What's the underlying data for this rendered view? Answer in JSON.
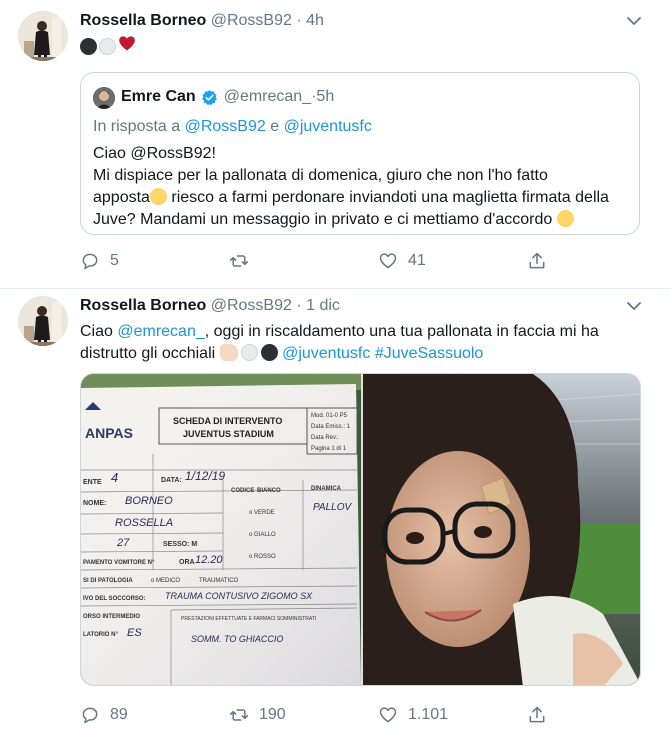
{
  "colors": {
    "link": "#1b95e0",
    "muted": "#657786",
    "text": "#14171a",
    "border": "#e6ecf0",
    "verified": "#1da1f2"
  },
  "tweet1": {
    "author_name": "Rossella Borneo",
    "handle": "@RossB92",
    "separator": " · ",
    "time": "4h",
    "emojis": [
      "black-circle",
      "white-circle",
      "red-heart"
    ],
    "quote": {
      "author_name": "Emre Can",
      "handle": "@emrecan_",
      "separator": " · ",
      "time": "5h",
      "reply_prefix": "In risposta a ",
      "reply_user1": "@RossB92",
      "reply_conj": " e ",
      "reply_user2": "@juventusfc",
      "line1": "Ciao @RossB92!",
      "line2": "Mi dispiace per la pallonata di domenica, giuro che non l'ho fatto",
      "line3_a": "apposta",
      "line3_b": " riesco a farmi perdonare inviandoti una maglietta firmata della",
      "line4": "Juve? Mandami un messaggio in privato e ci mettiamo d'accordo "
    },
    "actions": {
      "replies": "5",
      "retweets": "",
      "likes": "41"
    }
  },
  "tweet2": {
    "author_name": "Rossella Borneo",
    "handle": "@RossB92",
    "separator": " · ",
    "time": "1 dic",
    "text_a": "Ciao ",
    "mention": "@emrecan_",
    "text_b": ", oggi in riscaldamento una tua pallonata in faccia mi ha",
    "text_c": "distrutto gli occhiali ",
    "mention2": "@juventusfc",
    "hashtag": "#JuveSassuolo",
    "media": {
      "form": {
        "brand": "ANPAS",
        "title1": "SCHEDA DI INTERVENTO",
        "title2": "JUVENTUS STADIUM",
        "mod": "Mod. 01-0 P5",
        "data_emiss": "Data Emiss.: 1",
        "data_rev": "Data Rev.:",
        "pagina": "Pagina 1 di 1",
        "data_label": "DATA:",
        "data_value": "1/12/19",
        "num_label": "ENTE",
        "num_value": "4",
        "nome_label": "NOME:",
        "nome_value": "BORNEO",
        "cognome_value": "ROSSELLA",
        "eta_value": "27",
        "sesso_label": "SESSO: M",
        "ora_label": "ORA",
        "ora_value": "12.20",
        "vomitorio_label": "PAMENTO VOMITORE N°",
        "codice_label": "CODICE",
        "codice_bianco": "BIANCO",
        "codice_verde": "o VERDE",
        "codice_giallo": "o GIALLO",
        "codice_rosso": "o ROSSO",
        "dinamica_label": "DINAMICA",
        "dinamica_value": "PALLOV",
        "patologia_label": "SI DI PATOLOGIA",
        "medico": "o MEDICO",
        "traumatico": "TRAUMATICO",
        "soccorso_label": "IVO DEL SOCCORSO:",
        "soccorso_value": "TRAUMA CONTUSIVO ZIGOMO SX",
        "intermedio_label": "ORSO INTERMEDIO",
        "latorio_label": "LATORIO N°",
        "latorio_value": "ES",
        "prestazioni": "PRESTAZIONI EFFETTUATE E FARMACI SOMMINISTRATI",
        "prestazioni_value": "SOMM. TO GHIACCIO"
      }
    },
    "actions": {
      "replies": "89",
      "retweets": "190",
      "likes": "1.101"
    }
  }
}
